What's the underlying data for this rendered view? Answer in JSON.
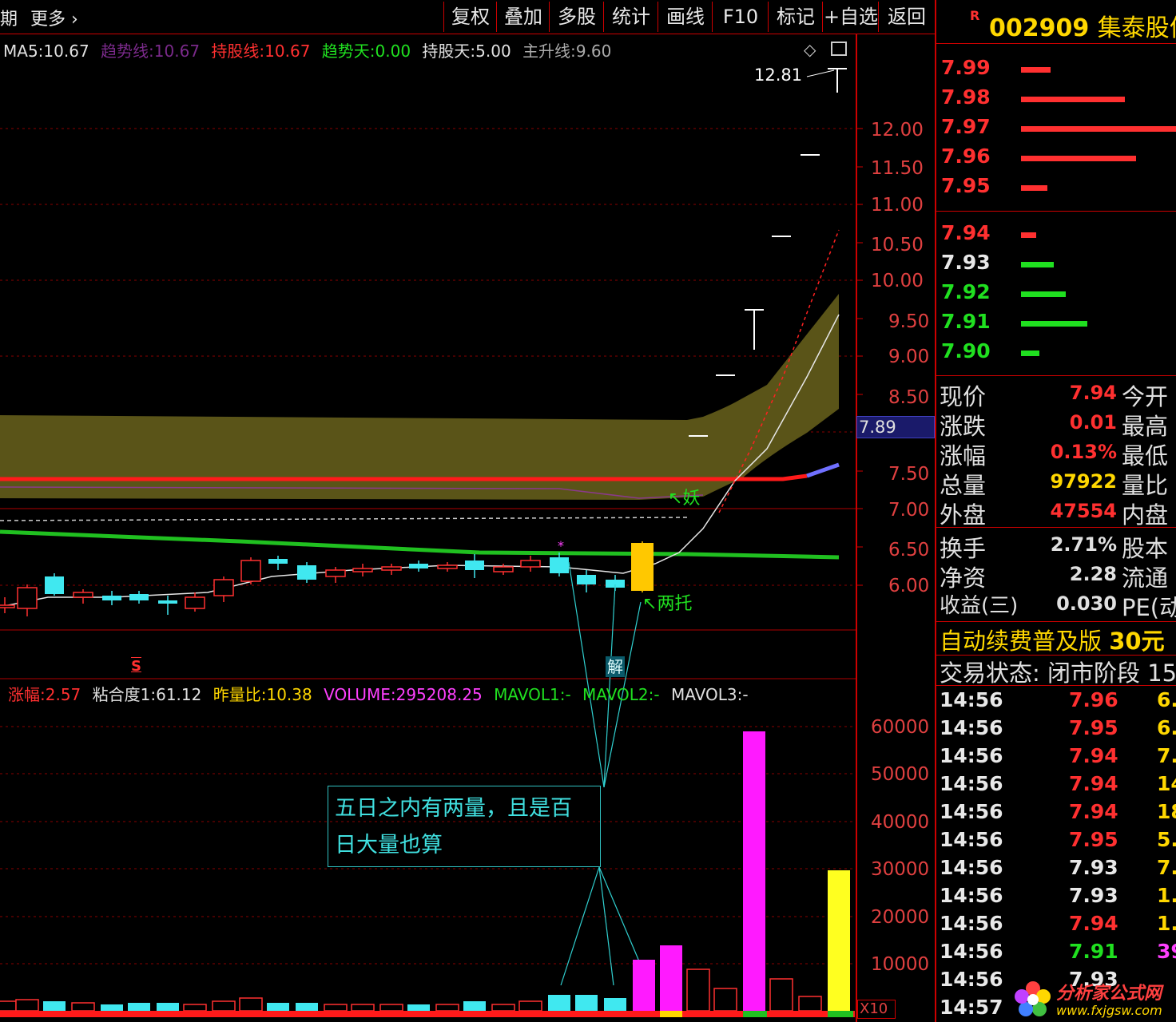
{
  "toolbar": {
    "left_items": [
      "期",
      "更多"
    ],
    "chevron": "chevron-right-icon",
    "buttons": [
      "复权",
      "叠加",
      "多股",
      "统计",
      "画线",
      "F10",
      "标记",
      "+自选",
      "返回"
    ]
  },
  "main_indicators": [
    {
      "label": "MA5:",
      "value": "10.67",
      "color": "#e0e0e0"
    },
    {
      "label": "趋势线:",
      "value": "10.67",
      "color": "#7a2a8a"
    },
    {
      "label": "持股线:",
      "value": "10.67",
      "color": "#ff3030"
    },
    {
      "label": "趋势天:",
      "value": "0.00",
      "color": "#20e020"
    },
    {
      "label": "持股天:",
      "value": "5.00",
      "color": "#e0e0e0"
    },
    {
      "label": "主升线:",
      "value": "9.60",
      "color": "#aaaaaa"
    }
  ],
  "price_axis": {
    "ticks": [
      "12.00",
      "11.50",
      "11.00",
      "10.50",
      "10.00",
      "9.50",
      "9.00",
      "8.50",
      "7.50",
      "7.00",
      "6.50",
      "6.00"
    ],
    "current_price_tag": "7.89",
    "high_annotation": "12.81"
  },
  "annotations": {
    "yao": "妖",
    "liangtuo": "两托",
    "jie": "解",
    "s_marker": "S",
    "callout_line1": "五日之内有两量，且是百",
    "callout_line2": "日大量也算"
  },
  "volume_indicators": [
    {
      "label": "涨幅:",
      "value": "2.57",
      "color": "#ff3030"
    },
    {
      "label": "粘合度1:",
      "value": "61.12",
      "color": "#e0e0e0"
    },
    {
      "label": "昨量比:",
      "value": "10.38",
      "color": "#ffd700"
    },
    {
      "label": "VOLUME:",
      "value": "295208.25",
      "color": "#ff40ff"
    },
    {
      "label": "MAVOL1:",
      "value": "-",
      "color": "#20e020"
    },
    {
      "label": "MAVOL2:",
      "value": "-",
      "color": "#20e020"
    },
    {
      "label": "MAVOL3:",
      "value": "-",
      "color": "#e0e0e0"
    }
  ],
  "volume_axis": {
    "ticks": [
      "60000",
      "50000",
      "40000",
      "30000",
      "20000",
      "10000"
    ],
    "unit": "X10"
  },
  "stock": {
    "marker": "R",
    "code": "002909",
    "name": "集泰股份"
  },
  "order_book": {
    "asks": [
      {
        "price": "7.99",
        "size": 0.19
      },
      {
        "price": "7.98",
        "size": 0.67
      },
      {
        "price": "7.97",
        "size": 1.0
      },
      {
        "price": "7.96",
        "size": 0.74
      },
      {
        "price": "7.95",
        "size": 0.17
      }
    ],
    "bids": [
      {
        "price": "7.94",
        "size": 0.1,
        "color": "#ff3030",
        "bar": "#ff3030"
      },
      {
        "price": "7.93",
        "size": 0.21,
        "color": "#e8e8e8",
        "bar": "#20e020"
      },
      {
        "price": "7.92",
        "size": 0.29,
        "color": "#20e020",
        "bar": "#20e020"
      },
      {
        "price": "7.91",
        "size": 0.43,
        "color": "#20e020",
        "bar": "#20e020"
      },
      {
        "price": "7.90",
        "size": 0.12,
        "color": "#20e020",
        "bar": "#20e020"
      }
    ]
  },
  "quote": [
    {
      "label": "现价",
      "value": "7.94",
      "color": "#ff3030",
      "right": "今开"
    },
    {
      "label": "涨跌",
      "value": "0.01",
      "color": "#ff3030",
      "right": "最高"
    },
    {
      "label": "涨幅",
      "value": "0.13%",
      "color": "#ff3030",
      "right": "最低"
    },
    {
      "label": "总量",
      "value": "97922",
      "color": "#ffd700",
      "right": "量比"
    },
    {
      "label": "外盘",
      "value": "47554",
      "color": "#ff3030",
      "right": "内盘"
    },
    {
      "label": "换手",
      "value": "2.71%",
      "color": "#e0e0e0",
      "right": "股本"
    },
    {
      "label": "净资",
      "value": "2.28",
      "color": "#e0e0e0",
      "right": "流通"
    },
    {
      "label": "收益(三)",
      "value": "0.030",
      "color": "#e0e0e0",
      "right": "PE(动"
    }
  ],
  "promo": {
    "text": "自动续费普及版",
    "price": "30元"
  },
  "trade_status": "交易状态: 闭市阶段 15",
  "ticks": [
    {
      "time": "14:56",
      "price": "7.96",
      "pcolor": "#ff3030",
      "vol": "6.",
      "vcolor": "#ffd700"
    },
    {
      "time": "14:56",
      "price": "7.95",
      "pcolor": "#ff3030",
      "vol": "6.",
      "vcolor": "#ffd700"
    },
    {
      "time": "14:56",
      "price": "7.94",
      "pcolor": "#ff3030",
      "vol": "7.",
      "vcolor": "#ffd700"
    },
    {
      "time": "14:56",
      "price": "7.94",
      "pcolor": "#ff3030",
      "vol": "14.",
      "vcolor": "#ffd700"
    },
    {
      "time": "14:56",
      "price": "7.94",
      "pcolor": "#ff3030",
      "vol": "18.",
      "vcolor": "#ffd700"
    },
    {
      "time": "14:56",
      "price": "7.95",
      "pcolor": "#ff3030",
      "vol": "5.",
      "vcolor": "#ffd700"
    },
    {
      "time": "14:56",
      "price": "7.93",
      "pcolor": "#e8e8e8",
      "vol": "7.",
      "vcolor": "#ffd700"
    },
    {
      "time": "14:56",
      "price": "7.93",
      "pcolor": "#e8e8e8",
      "vol": "1.",
      "vcolor": "#ffd700"
    },
    {
      "time": "14:56",
      "price": "7.94",
      "pcolor": "#ff3030",
      "vol": "1.",
      "vcolor": "#ffd700"
    },
    {
      "time": "14:56",
      "price": "7.91",
      "pcolor": "#20e020",
      "vol": "39.",
      "vcolor": "#ff40ff"
    },
    {
      "time": "14:56",
      "price": "7.93",
      "pcolor": "#e8e8e8",
      "vol": "",
      "vcolor": "#ffd700"
    },
    {
      "time": "14:57",
      "price": "",
      "pcolor": "#ff3030",
      "vol": "",
      "vcolor": "#ffd700"
    }
  ],
  "watermark": {
    "name": "分析家公式网",
    "url": "www.fxjgsw.com"
  }
}
